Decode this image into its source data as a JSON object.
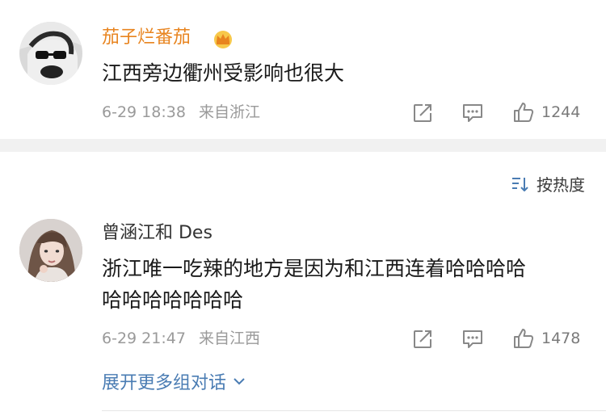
{
  "comments": [
    {
      "username": "茄子烂番茄",
      "text_lines": [
        "江西旁边衢州受影响也很大"
      ],
      "time": "6-29 18:38",
      "location": "来自浙江",
      "likes": "1244"
    },
    {
      "username": "曾涵江和 Des",
      "text_lines": [
        "浙江唯一吃辣的地方是因为和江西连着哈哈哈哈",
        "哈哈哈哈哈哈哈"
      ],
      "time": "6-29 21:47",
      "location": "来自江西",
      "likes": "1478"
    }
  ],
  "sort": {
    "label": "按热度"
  },
  "expand": {
    "label": "展开更多组对话"
  },
  "colors": {
    "vip_name": "#e8841f",
    "link": "#4a7cb3",
    "meta": "#9a9a9a",
    "separator": "#f1f1f1"
  },
  "icons": [
    "crown-badge-icon",
    "share-icon",
    "reply-icon",
    "like-icon",
    "sort-icon",
    "chevron-down-icon"
  ]
}
